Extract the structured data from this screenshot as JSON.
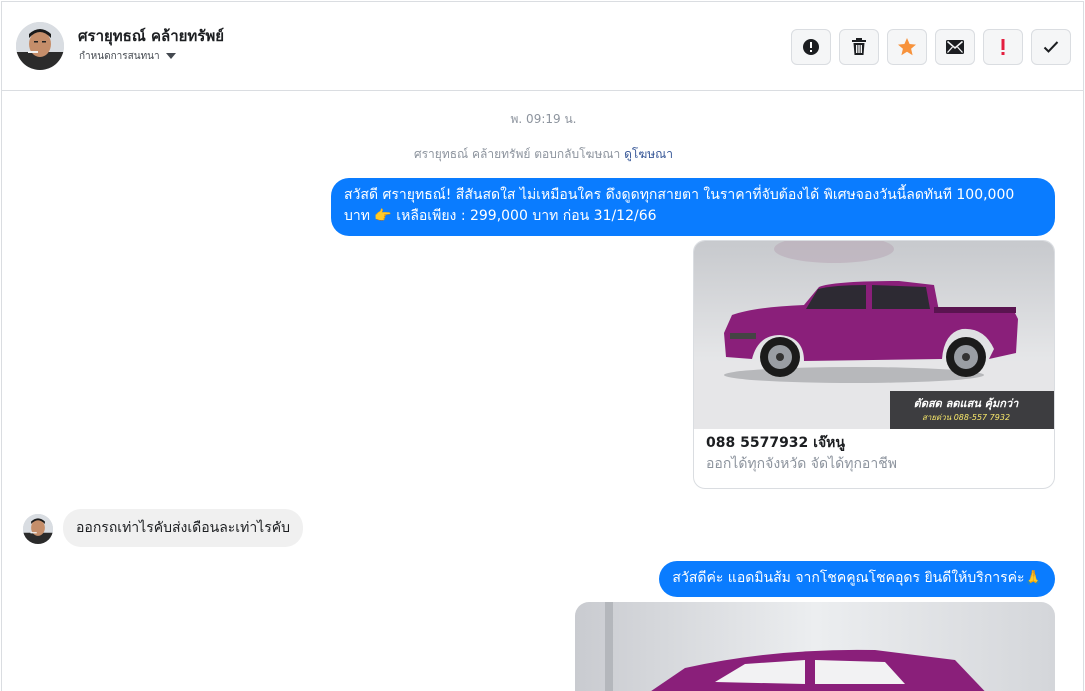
{
  "header": {
    "contact_name": "ศรายุทธณ์ คล้ายทรัพย์",
    "assign_label": "กำหนดการสนทนา",
    "actions": [
      {
        "icon": "alert-circle-icon"
      },
      {
        "icon": "trash-icon"
      },
      {
        "icon": "star-icon",
        "color": "#f7923b"
      },
      {
        "icon": "envelope-icon"
      },
      {
        "icon": "exclamation-icon",
        "color": "#e41e3f"
      },
      {
        "icon": "checkmark-icon"
      }
    ]
  },
  "conversation": {
    "timestamp": "พ. 09:19 น.",
    "system_text": "ศรายุทธณ์ คล้ายทรัพย์ ตอบกลับโฆษณา",
    "system_link": "ดูโฆษณา",
    "messages": [
      {
        "from": "page",
        "text": "สวัสดี ศรายุทธณ์! สีสันสดใส ไม่เหมือนใคร ดึงดูดทุกสายตา ในราคาที่จับต้องได้ พิเศษจองวันนี้ลดทันที 100,000 บาท 👉 เหลือเพียง : 299,000 บาท ก่อน 31/12/66"
      },
      {
        "from": "page",
        "type": "ad_card",
        "title": "088 5577932 เจ๊หนู",
        "subtitle": "ออกได้ทุกจังหวัด จัดได้ทุกอาชีพ",
        "overlay_line1": "ตัดสด ลดแสน คุ้มกว่า",
        "overlay_line2": "สายด่วน 088-557 7932"
      },
      {
        "from": "customer",
        "text": "ออกรถเท่าไรคับส่งเดือนละเท่าไรคับ"
      },
      {
        "from": "page",
        "text": "สวัสดีค่ะ แอดมินส้ม จากโชคคูณโชคอุดร ยินดีให้บริการค่ะ🙏"
      }
    ]
  },
  "colors": {
    "outgoing_bubble": "#0a7cff",
    "incoming_bubble": "#f0f0f0",
    "car_body": "#8a1f7a"
  }
}
